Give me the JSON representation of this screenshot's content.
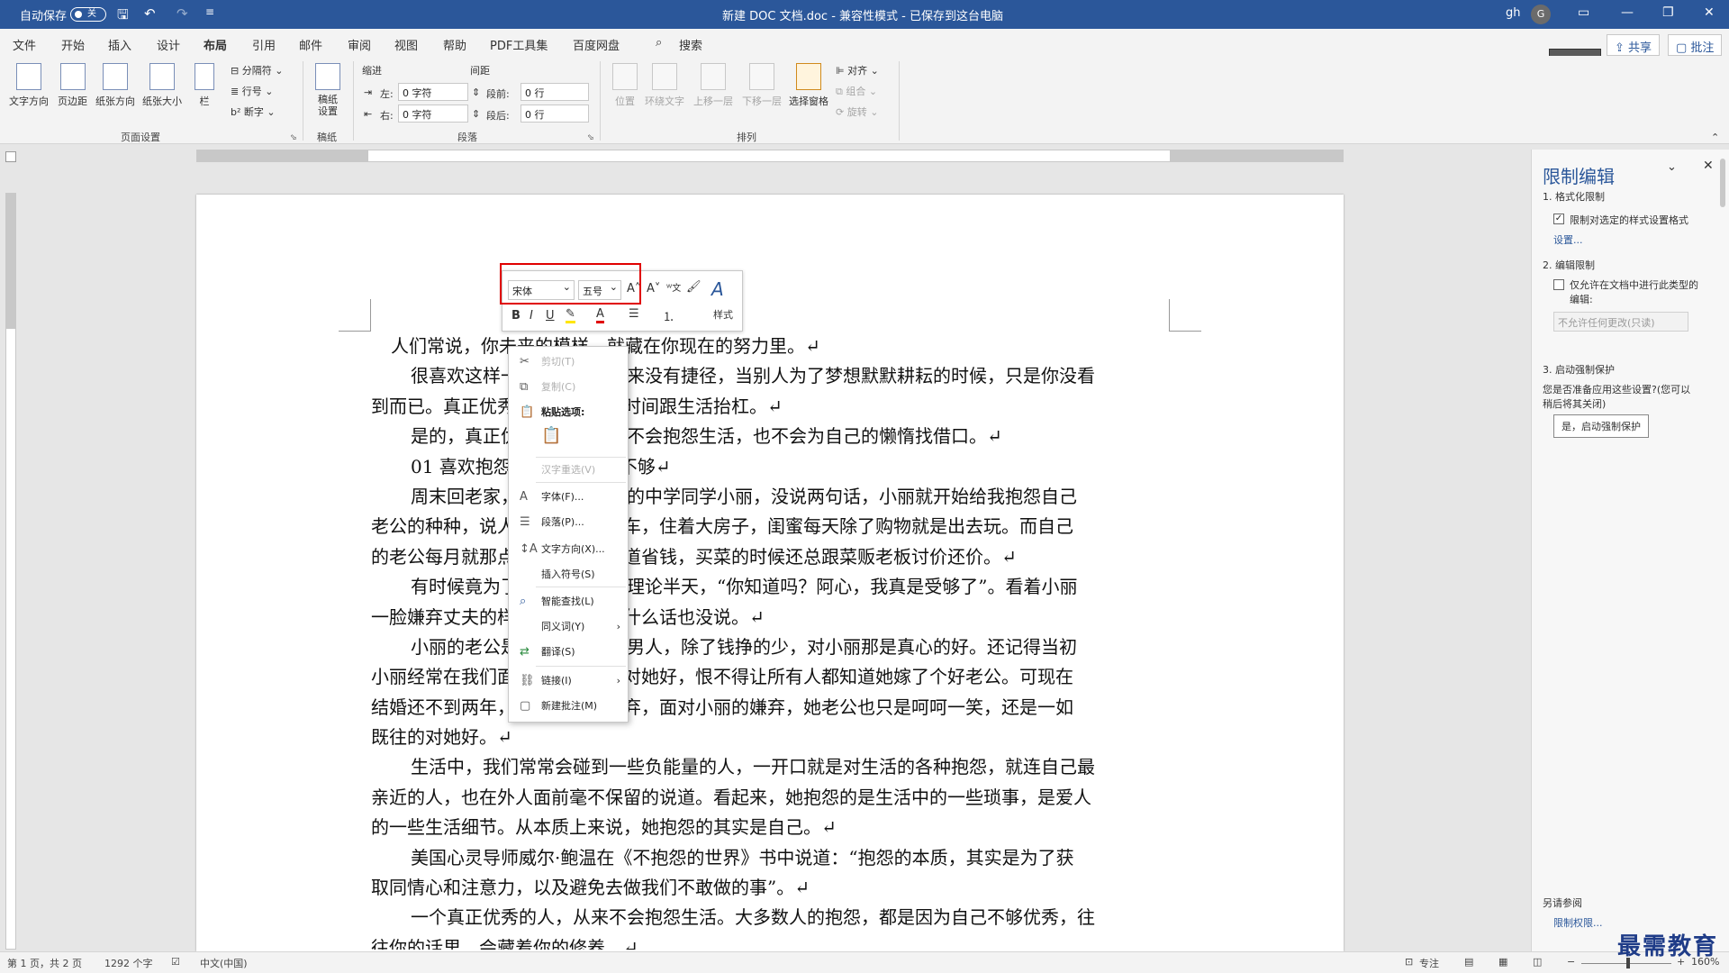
{
  "title_bar": {
    "autosave_label": "自动保存",
    "autosave_state": "关",
    "doc_title": "新建 DOC 文档.doc  -  兼容性模式  -  已保存到这台电脑",
    "user_initials": "gh",
    "avatar_letter": "G"
  },
  "tabs": [
    "文件",
    "开始",
    "插入",
    "设计",
    "布局",
    "引用",
    "邮件",
    "审阅",
    "视图",
    "帮助",
    "PDF工具集",
    "百度网盘",
    "搜索"
  ],
  "share": {
    "share_label": "共享",
    "comment_label": "批注"
  },
  "ribbon": {
    "page_setup": {
      "group_label": "页面设置",
      "text_direction": "文字方向",
      "margins": "页边距",
      "orientation": "纸张方向",
      "size": "纸张大小",
      "columns": "栏",
      "breaks": "分隔符",
      "line_numbers": "行号",
      "hyphenation": "断字"
    },
    "draft": {
      "group_label": "稿纸",
      "draft_setup": "稿纸\n设置"
    },
    "paragraph": {
      "group_label": "段落",
      "indent_label": "缩进",
      "spacing_label": "间距",
      "left_label": "左:",
      "right_label": "右:",
      "before_label": "段前:",
      "after_label": "段后:",
      "left_value": "0 字符",
      "right_value": "0 字符",
      "before_value": "0 行",
      "after_value": "0 行"
    },
    "arrange": {
      "group_label": "排列",
      "position": "位置",
      "wrap_text": "环绕文字",
      "bring_forward": "上移一层",
      "send_backward": "下移一层",
      "selection_pane": "选择窗格",
      "align": "对齐",
      "group": "组合",
      "rotate": "旋转"
    }
  },
  "mini_toolbar": {
    "font": "宋体",
    "size": "五号",
    "styles_label": "样式"
  },
  "context_menu": {
    "cut": "剪切(T)",
    "copy": "复制(C)",
    "paste_options": "粘贴选项:",
    "reconvert": "汉字重选(V)",
    "font": "字体(F)...",
    "paragraph": "段落(P)...",
    "text_direction": "文字方向(X)...",
    "insert_symbol": "插入符号(S)",
    "smart_lookup": "智能查找(L)",
    "synonyms": "同义词(Y)",
    "translate": "翻译(S)",
    "link": "链接(I)",
    "new_comment": "新建批注(M)"
  },
  "document": {
    "paragraphs": [
      {
        "text": "人们常说，你未来的模样，就藏在你现在的努力里。↵",
        "indent": false
      },
      {
        "text": "很喜欢这样一句话：成长从来没有捷径，当别人为了梦想默默耕耘的时候，只是你没看",
        "indent": true
      },
      {
        "text": "到而已。真正优秀的人，从不花时间跟生活抬杠。↵",
        "indent": false
      },
      {
        "text": "是的，真正优秀的人，从来不会抱怨生活，也不会为自己的懒惰找借口。↵",
        "indent": true
      },
      {
        "text": "01  喜欢抱怨的人，是修养不够↵",
        "indent": true
      },
      {
        "text": "周末回老家，碰到许久不见的中学同学小丽，没说两句话，小丽就开始给我抱怨自己",
        "indent": true
      },
      {
        "text": "老公的种种，说人家老公开着豪车，住着大房子，闺蜜每天除了购物就是出去玩。而自己",
        "indent": false
      },
      {
        "text": "的老公每月就那点死工资，就知道省钱，买菜的时候还总跟菜贩老板讨价还价。↵",
        "indent": false
      },
      {
        "text": "有时候竟为了一毛钱跟人家理论半天，“你知道吗？阿心，我真是受够了”。看着小丽",
        "indent": true
      },
      {
        "text": "一脸嫌弃丈夫的样子，我笑笑，什么话也没说。↵",
        "indent": false
      },
      {
        "text": "小丽的老公是个本本分分的男人，除了钱挣的少，对小丽那是真心的好。还记得当初",
        "indent": true
      },
      {
        "text": "小丽经常在我们面前炫耀他如何对她好，恨不得让所有人都知道她嫁了个好老公。可现在",
        "indent": false
      },
      {
        "text": "结婚还不到两年，就开始各种嫌弃，面对小丽的嫌弃，她老公也只是呵呵一笑，还是一如",
        "indent": false
      },
      {
        "text": "既往的对她好。↵",
        "indent": false
      },
      {
        "text": "生活中，我们常常会碰到一些负能量的人，一开口就是对生活的各种抱怨，就连自己最",
        "indent": true
      },
      {
        "text": "亲近的人，也在外人面前毫不保留的说道。看起来，她抱怨的是生活中的一些琐事，是爱人",
        "indent": false
      },
      {
        "text": "的一些生活细节。从本质上来说，她抱怨的其实是自己。↵",
        "indent": false
      },
      {
        "text": "美国心灵导师威尔·鲍温在《不抱怨的世界》书中说道：“抱怨的本质，其实是为了获",
        "indent": true
      },
      {
        "text": "取同情心和注意力，以及避免去做我们不敢做的事”。↵",
        "indent": false
      },
      {
        "text": "一个真正优秀的人，从来不会抱怨生活。大多数人的抱怨，都是因为自己不够优秀，往",
        "indent": true
      },
      {
        "text": "往你的话里，会藏着你的修养。↵",
        "indent": false
      }
    ]
  },
  "restrict_pane": {
    "title": "限制编辑",
    "s1": "1. 格式化限制",
    "s1_check": "限制对选定的样式设置格式",
    "s1_link": "设置...",
    "s2": "2. 编辑限制",
    "s2_check_l1": "仅允许在文档中进行此类型的",
    "s2_check_l2": "编辑:",
    "s2_select": "不允许任何更改(只读)",
    "s3": "3. 启动强制保护",
    "s3_desc_l1": "您是否准备应用这些设置?(您可以",
    "s3_desc_l2": "稍后将其关闭)",
    "s3_button": "是，启动强制保护",
    "see_also": "另请参阅",
    "permissions_link": "限制权限..."
  },
  "status_bar": {
    "page": "第 1 页，共 2 页",
    "words": "1292 个字",
    "language": "中文(中国)",
    "focus": "专注",
    "zoom": "160%"
  },
  "watermark": "最需教育"
}
